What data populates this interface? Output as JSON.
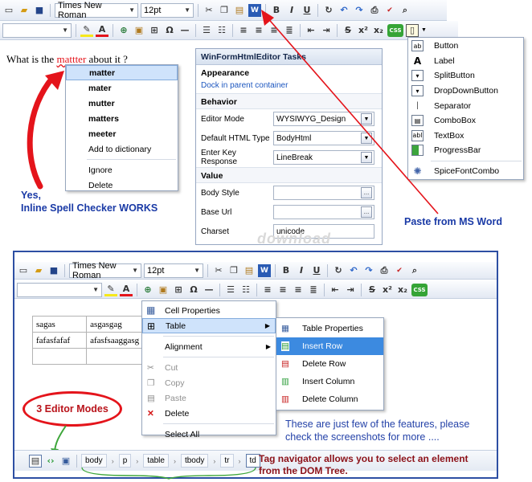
{
  "top_toolbar": {
    "font_name": "Times New Roman",
    "font_size": "12pt",
    "format_icons": [
      "B",
      "I",
      "U"
    ]
  },
  "editor": {
    "text_before": "What is the ",
    "misspelled": "mattter",
    "text_after": " about it ?"
  },
  "spell_menu": {
    "items": [
      "matter",
      "mater",
      "mutter",
      "matters",
      "meeter"
    ],
    "add": "Add to dictionary",
    "ignore": "Ignore",
    "delete": "Delete"
  },
  "tasks_panel": {
    "title": "WinFormHtmlEditor Tasks",
    "appearance": "Appearance",
    "dock_link": "Dock in parent container",
    "behavior": "Behavior",
    "editor_mode_label": "Editor Mode",
    "editor_mode_value": "WYSIWYG_Design",
    "default_html_label": "Default HTML Type",
    "default_html_value": "BodyHtml",
    "enter_key_label": "Enter Key Response",
    "enter_key_value": "LineBreak",
    "value": "Value",
    "body_style_label": "Body Style",
    "base_url_label": "Base Url",
    "charset_label": "Charset",
    "charset_value": "unicode"
  },
  "controls_menu": {
    "items": [
      "Button",
      "Label",
      "SplitButton",
      "DropDownButton",
      "Separator",
      "ComboBox",
      "TextBox",
      "ProgressBar",
      "SpiceFontCombo"
    ]
  },
  "captions": {
    "spell_line1": "Yes,",
    "spell_line2": "Inline Spell Checker WORKS",
    "paste": "Paste from MS Word",
    "watermark": "download",
    "editor_modes": "3 Editor Modes",
    "features_line1": "These are just few of the features, please",
    "features_line2": "check the screenshots for more ....",
    "tag_nav_line1": "Tag navigator allows you to select an element",
    "tag_nav_line2": "from the DOM Tree."
  },
  "bottom_toolbar": {
    "font_name": "Times New Roman",
    "font_size": "12pt"
  },
  "table": {
    "rows": [
      [
        "sagas",
        "asgasgag"
      ],
      [
        "fafasfafaf",
        "afasfsaaggasg"
      ],
      [
        "",
        ""
      ]
    ]
  },
  "context_menu": {
    "cell_properties": "Cell Properties",
    "table": "Table",
    "alignment": "Alignment",
    "cut": "Cut",
    "copy": "Copy",
    "paste": "Paste",
    "delete": "Delete",
    "select_all": "Select All"
  },
  "table_submenu": {
    "items": [
      "Table Properties",
      "Insert Row",
      "Delete Row",
      "Insert Column",
      "Delete Column"
    ]
  },
  "tag_nav": {
    "crumbs": [
      "body",
      "p",
      "table",
      "tbody",
      "tr",
      "td"
    ]
  },
  "colors": {
    "accent_red": "#e4141b",
    "caption_blue": "#1a3aa6",
    "frame_blue": "#2d4fa3"
  }
}
